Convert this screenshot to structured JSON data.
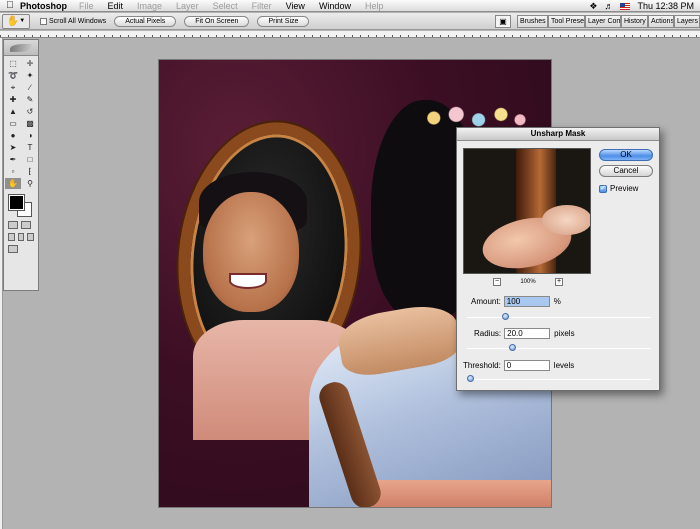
{
  "menubar": {
    "app_name": "Photoshop",
    "items": [
      "File",
      "Edit",
      "Image",
      "Layer",
      "Select",
      "Filter",
      "View",
      "Window",
      "Help"
    ],
    "dimmed_items": [
      "File",
      "Image",
      "Layer",
      "Select",
      "Filter",
      "Help"
    ],
    "clock": "Thu 12:38 PM"
  },
  "options_bar": {
    "scroll_all_windows_label": "Scroll All Windows",
    "scroll_all_windows_checked": false,
    "actual_pixels_label": "Actual Pixels",
    "fit_on_screen_label": "Fit On Screen",
    "print_size_label": "Print Size",
    "panel_tabs": [
      "Brushes",
      "Tool Presets",
      "Layer Comps",
      "History",
      "Actions",
      "Layers"
    ]
  },
  "tools_palette": {
    "active_tool": "hand-tool",
    "foreground_color": "#000000",
    "background_color": "#ffffff"
  },
  "dialog": {
    "title": "Unsharp Mask",
    "ok_label": "OK",
    "cancel_label": "Cancel",
    "preview_label": "Preview",
    "preview_checked": true,
    "zoom_level": "100%",
    "amount": {
      "label": "Amount:",
      "value": "100",
      "unit": "%",
      "slider_fraction": 0.2
    },
    "radius": {
      "label": "Radius:",
      "value": "20.0",
      "unit": "pixels",
      "slider_fraction": 0.24
    },
    "threshold": {
      "label": "Threshold:",
      "value": "0",
      "unit": "levels",
      "slider_fraction": 0.0
    }
  }
}
